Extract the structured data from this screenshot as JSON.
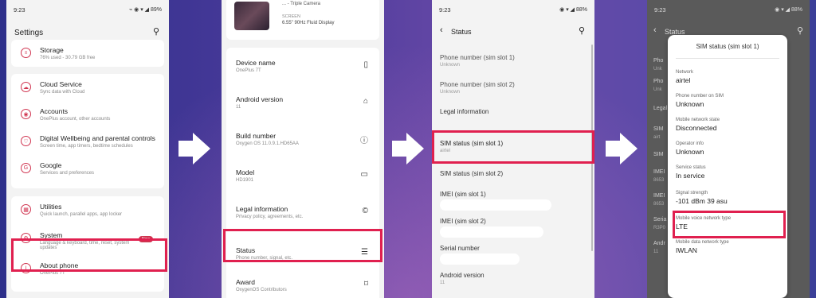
{
  "phone1": {
    "status_time": "9:23",
    "status_right": "⌁ ◉ ▾ ◢ 89%",
    "title": "Settings",
    "storage": {
      "title": "Storage",
      "sub": "76% used - 30.79 GB free"
    },
    "group1": [
      {
        "title": "Cloud Service",
        "sub": "Sync data with Cloud"
      },
      {
        "title": "Accounts",
        "sub": "OnePlus account, other accounts"
      },
      {
        "title": "Digital Wellbeing and parental controls",
        "sub": "Screen time, app timers, bedtime schedules"
      },
      {
        "title": "Google",
        "sub": "Services and preferences"
      }
    ],
    "group2": [
      {
        "title": "Utilities",
        "sub": "Quick launch, parallel apps, app locker"
      },
      {
        "title": "System",
        "sub": "Language & keyboard, time, reset, system updates",
        "badge": "New"
      },
      {
        "title": "About phone",
        "sub": "OnePlus 7T"
      }
    ]
  },
  "phone2": {
    "top_title": "... - Triple Camera",
    "screen_label": "SCREEN",
    "screen_value": "6.55\" 90Hz Fluid Display",
    "rows": [
      {
        "title": "Device name",
        "sub": "OnePlus 7T"
      },
      {
        "title": "Android version",
        "sub": "11"
      },
      {
        "title": "Build number",
        "sub": "Oxygen OS 11.0.9.1.HD65AA"
      },
      {
        "title": "Model",
        "sub": "HD1901"
      },
      {
        "title": "Legal information",
        "sub": "Privacy policy, agreements, etc."
      },
      {
        "title": "Status",
        "sub": "Phone number, signal, etc."
      },
      {
        "title": "Award",
        "sub": "OxygenOS Contributors"
      }
    ]
  },
  "phone3": {
    "status_time": "9:23",
    "status_right": "◉ ▾ ◢ 88%",
    "title": "Status",
    "rows": [
      {
        "title": "Phone number (sim slot 1)",
        "sub": "Unknown"
      },
      {
        "title": "Phone number (sim slot 2)",
        "sub": "Unknown"
      },
      {
        "title": "Legal information",
        "sub": ""
      },
      {
        "title": "SIM status (sim slot 1)",
        "sub": "airtel"
      },
      {
        "title": "SIM status (sim slot 2)",
        "sub": ""
      },
      {
        "title": "IMEI (sim slot 1)",
        "sub": ""
      },
      {
        "title": "IMEI (sim slot 2)",
        "sub": ""
      },
      {
        "title": "Serial number",
        "sub": ""
      },
      {
        "title": "Android version",
        "sub": "11"
      }
    ]
  },
  "phone4": {
    "status_time": "9:23",
    "status_right": "◉ ▾ ◢ 88%",
    "back_title": "Status",
    "dialog_title": "SIM status (sim slot 1)",
    "fields": [
      {
        "label": "Network",
        "value": "airtel"
      },
      {
        "label": "Phone number on SIM",
        "value": "Unknown"
      },
      {
        "label": "Mobile network state",
        "value": "Disconnected"
      },
      {
        "label": "Operator info",
        "value": "Unknown"
      },
      {
        "label": "Service status",
        "value": "In service"
      },
      {
        "label": "Signal strength",
        "value": "-101 dBm 39 asu"
      },
      {
        "label": "Mobile voice network type",
        "value": "LTE"
      },
      {
        "label": "Mobile data network type",
        "value": "IWLAN"
      }
    ],
    "bg_rows": [
      "Pho",
      "Unk",
      "Pho",
      "Unk",
      "Legal",
      "SIM",
      "airt",
      "SIM",
      "IMEI",
      "8653",
      "IMEI",
      "8653",
      "Seria",
      "R3P0",
      "Andr",
      "11"
    ]
  },
  "colors": {
    "highlight": "#e0204f",
    "accent": "#d0334f"
  }
}
